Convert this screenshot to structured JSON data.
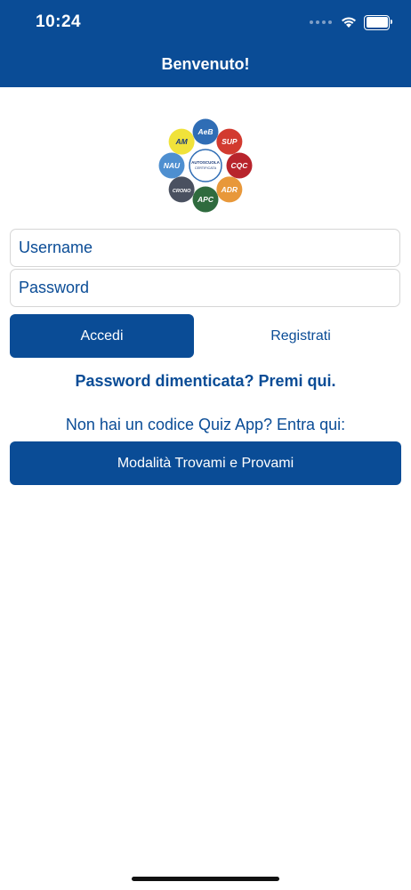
{
  "status_bar": {
    "time": "10:24"
  },
  "header": {
    "title": "Benvenuto!"
  },
  "logo": {
    "center_text_1": "AUTOSCUOLA",
    "center_text_2": "CERTIFICATA",
    "petals": [
      {
        "label": "AeB",
        "color": "#2f6db5"
      },
      {
        "label": "SUP",
        "color": "#d23a2f"
      },
      {
        "label": "CQC",
        "color": "#b8242c"
      },
      {
        "label": "ADR",
        "color": "#e8983a"
      },
      {
        "label": "APC",
        "color": "#2f6b3e"
      },
      {
        "label": "CRONO",
        "color": "#4a5160"
      },
      {
        "label": "NAU",
        "color": "#4e8fd0"
      },
      {
        "label": "AM",
        "color": "#f0e23a"
      }
    ]
  },
  "form": {
    "username_placeholder": "Username",
    "password_placeholder": "Password",
    "login_label": "Accedi",
    "register_label": "Registrati"
  },
  "forgot_password": "Password dimenticata? Premi qui.",
  "quiz_hint": "Non hai un codice Quiz App? Entra qui:",
  "trial_button": "Modalità Trovami e Provami",
  "colors": {
    "brand": "#0a4c96",
    "background": "#ffffff"
  }
}
